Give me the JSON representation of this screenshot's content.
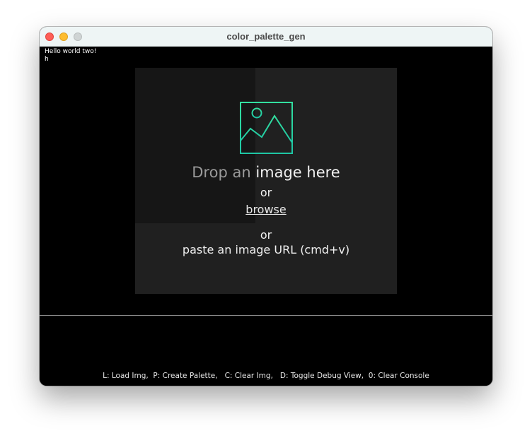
{
  "window": {
    "title": "color_palette_gen"
  },
  "console": {
    "lines": [
      "Hello world two!",
      "h"
    ]
  },
  "dropzone": {
    "title_dim": "Drop an ",
    "title_bright": "image here",
    "or_1": "or",
    "browse": "browse",
    "or_2": "or",
    "paste_hint": "paste an image URL (cmd+v)",
    "icon": "image-icon",
    "accent_color": "#2ee6a8"
  },
  "footer": {
    "shortcuts": "L: Load Img,  P: Create Palette,   C: Clear Img,   D: Toggle Debug View,  0: Clear Console"
  }
}
